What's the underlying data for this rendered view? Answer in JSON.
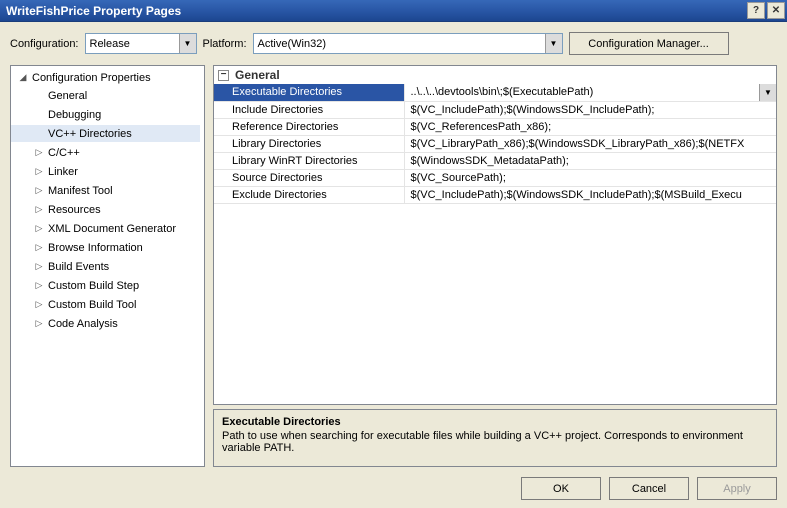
{
  "window": {
    "title": "WriteFishPrice Property Pages"
  },
  "toolbar": {
    "configuration_label": "Configuration:",
    "configuration_value": "Release",
    "platform_label": "Platform:",
    "platform_value": "Active(Win32)",
    "config_manager_label": "Configuration Manager..."
  },
  "tree": {
    "root_label": "Configuration Properties",
    "items": [
      {
        "label": "General",
        "has_children": false
      },
      {
        "label": "Debugging",
        "has_children": false
      },
      {
        "label": "VC++ Directories",
        "has_children": false,
        "selected": true
      },
      {
        "label": "C/C++",
        "has_children": true
      },
      {
        "label": "Linker",
        "has_children": true
      },
      {
        "label": "Manifest Tool",
        "has_children": true
      },
      {
        "label": "Resources",
        "has_children": true
      },
      {
        "label": "XML Document Generator",
        "has_children": true
      },
      {
        "label": "Browse Information",
        "has_children": true
      },
      {
        "label": "Build Events",
        "has_children": true
      },
      {
        "label": "Custom Build Step",
        "has_children": true
      },
      {
        "label": "Custom Build Tool",
        "has_children": true
      },
      {
        "label": "Code Analysis",
        "has_children": true
      }
    ]
  },
  "grid": {
    "group_title": "General",
    "rows": [
      {
        "name": "Executable Directories",
        "value": "..\\..\\..\\devtools\\bin\\;$(ExecutablePath)",
        "selected": true
      },
      {
        "name": "Include Directories",
        "value": "$(VC_IncludePath);$(WindowsSDK_IncludePath);"
      },
      {
        "name": "Reference Directories",
        "value": "$(VC_ReferencesPath_x86);"
      },
      {
        "name": "Library Directories",
        "value": "$(VC_LibraryPath_x86);$(WindowsSDK_LibraryPath_x86);$(NETFX"
      },
      {
        "name": "Library WinRT Directories",
        "value": "$(WindowsSDK_MetadataPath);"
      },
      {
        "name": "Source Directories",
        "value": "$(VC_SourcePath);"
      },
      {
        "name": "Exclude Directories",
        "value": "$(VC_IncludePath);$(WindowsSDK_IncludePath);$(MSBuild_Execu"
      }
    ]
  },
  "description": {
    "title": "Executable Directories",
    "body": "Path to use when searching for executable files while building a VC++ project.  Corresponds to environment variable PATH."
  },
  "buttons": {
    "ok": "OK",
    "cancel": "Cancel",
    "apply": "Apply"
  }
}
